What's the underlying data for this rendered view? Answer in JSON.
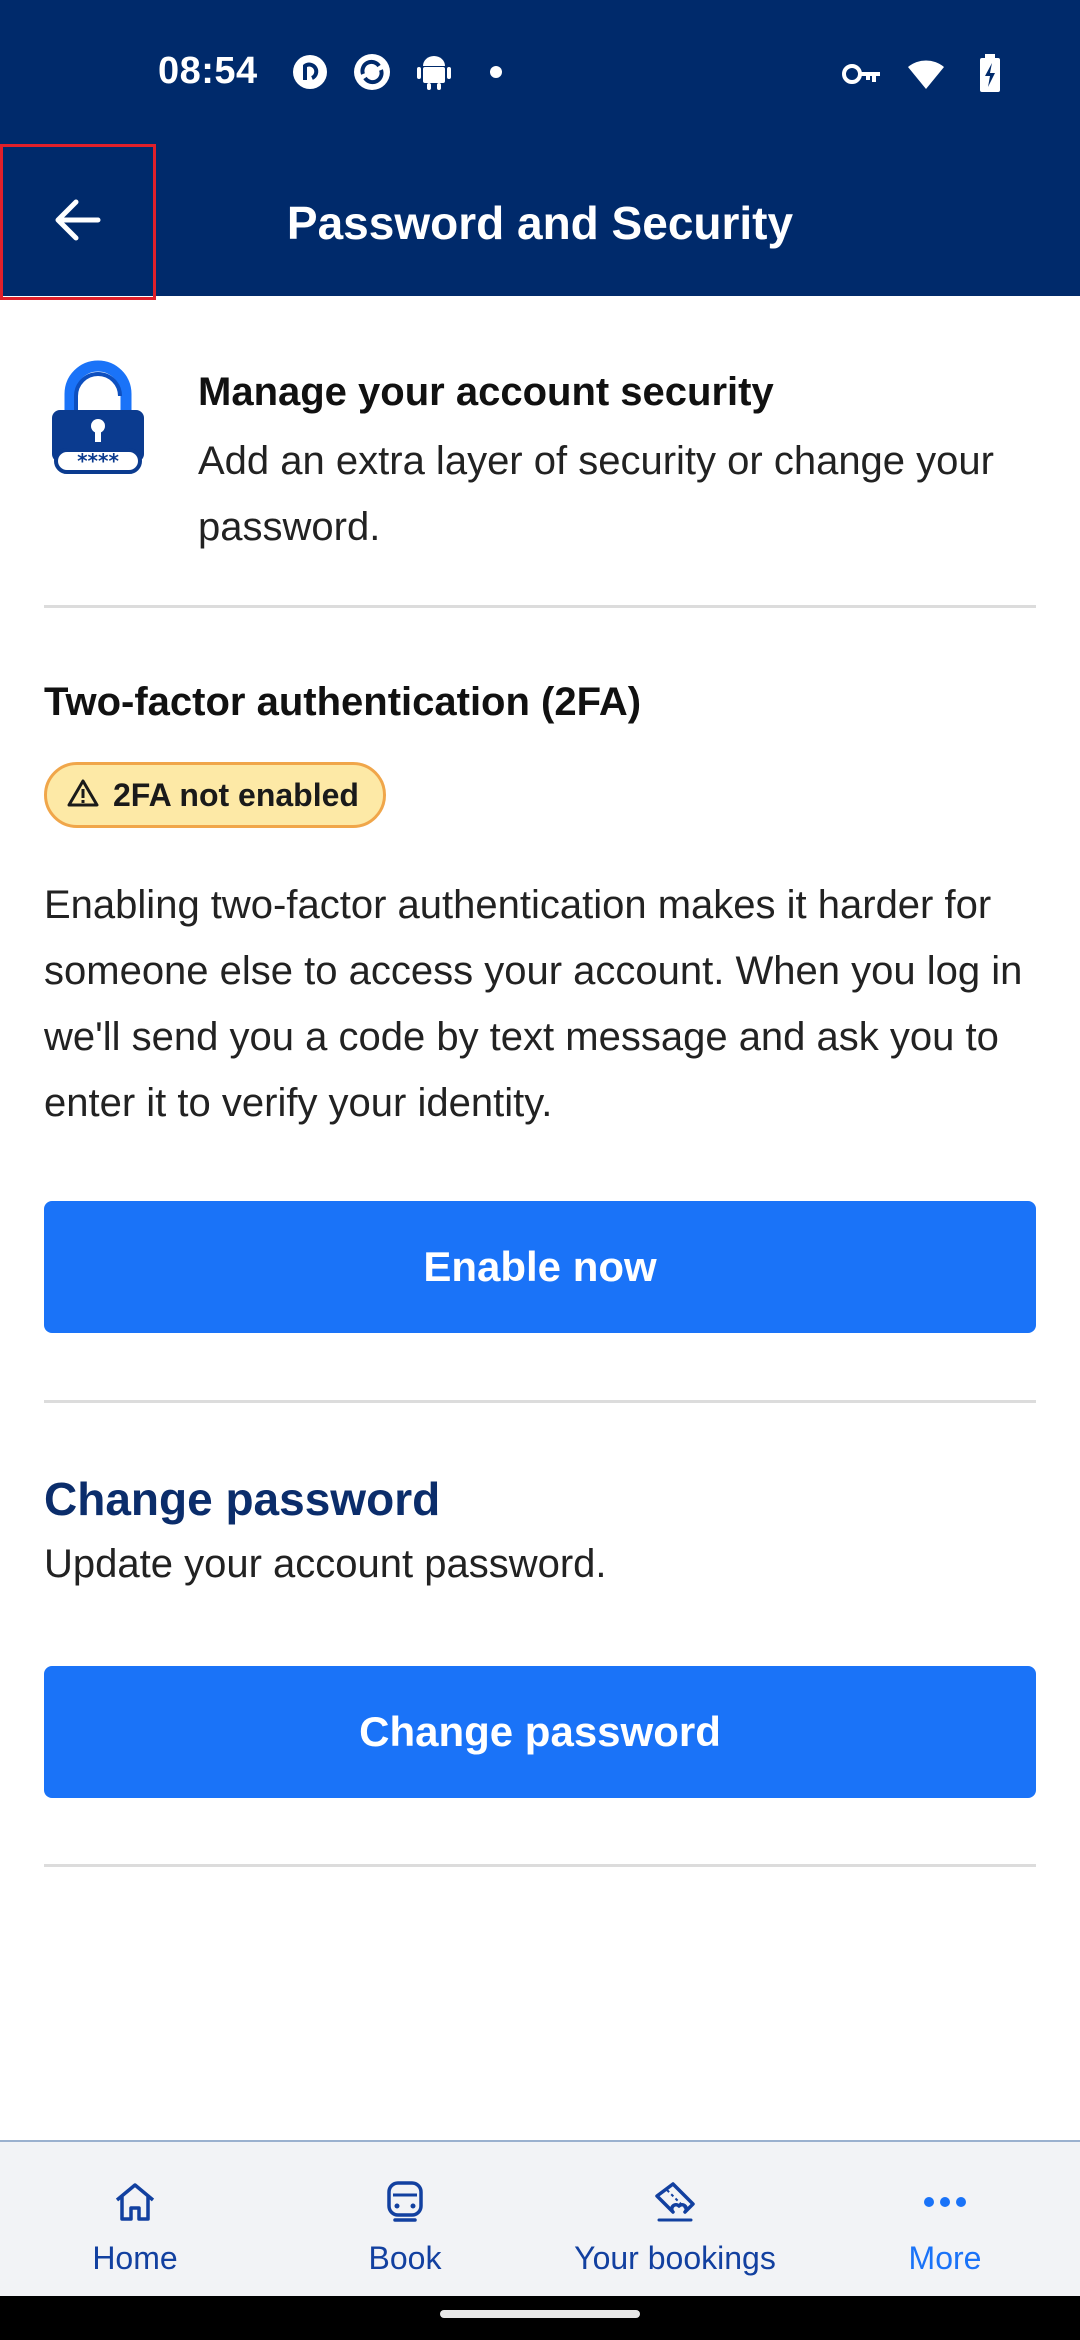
{
  "status_bar": {
    "time": "08:54",
    "left_icons": [
      "pocket-casts-icon",
      "browser-sync-icon",
      "android-icon",
      "notification-dot-icon"
    ],
    "right_icons": [
      "vpn-key-icon",
      "wifi-icon",
      "battery-charging-icon"
    ]
  },
  "app_bar": {
    "title": "Password and Security",
    "back_icon": "arrow-left-icon"
  },
  "intro": {
    "icon": "padlock-password-icon",
    "title": "Manage your account security",
    "description": "Add an extra layer of security or change your password."
  },
  "two_factor": {
    "title": "Two-factor authentication (2FA)",
    "badge": {
      "icon": "warning-triangle-icon",
      "text": "2FA not enabled"
    },
    "description": "Enabling two-factor authentication makes it harder for someone else to access your account. When you log in we'll send you a code by text message and ask you to enter it to verify your identity.",
    "button_label": "Enable now"
  },
  "change_password": {
    "title": "Change password",
    "description": "Update your account password.",
    "button_label": "Change password"
  },
  "bottom_nav": {
    "items": [
      {
        "label": "Home",
        "icon": "home-icon"
      },
      {
        "label": "Book",
        "icon": "train-icon"
      },
      {
        "label": "Your bookings",
        "icon": "ticket-icon"
      },
      {
        "label": "More",
        "icon": "more-dots-icon"
      }
    ],
    "active": "More"
  },
  "colors": {
    "header_bg": "#002a6b",
    "primary_button": "#1a73f8",
    "badge_bg": "#fde9a6",
    "badge_border": "#f0a64a",
    "section_title": "#0b2d6b"
  }
}
